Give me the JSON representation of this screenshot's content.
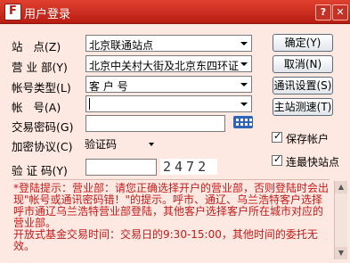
{
  "window": {
    "title": "用户登录",
    "help_label": "?",
    "close_label": "✕"
  },
  "form": {
    "station_label": "站   点(Z)",
    "station_value": "北京联通站点",
    "branch_label": "营 业 部(Y)",
    "branch_value": "北京中关村大街及北京东四环证",
    "account_type_label": "帐号类型(L)",
    "account_type_value": "客 户 号",
    "account_label": "帐   号(A)",
    "account_value": "",
    "password_label": "交易密码(G)",
    "encrypt_label": "加密协议(C)",
    "encrypt_value": "验证码",
    "captcha_label": "验 证 码(Y)",
    "captcha_value": "",
    "captcha_text": "2472"
  },
  "buttons": {
    "ok": "确定(Y)",
    "cancel": "取消(N)",
    "comm_settings": "通讯设置(S)",
    "speed_test": "主站测速(T)"
  },
  "options": {
    "save_account": {
      "label": "保存帐户",
      "checked": true
    },
    "fastest_station": {
      "label": "连最快站点",
      "checked": true
    }
  },
  "notice": "*登陆提示：营业部：请您正确选择开户的营业部，否则登陆时会出现\"帐号或通讯密码错！\"的提示。呼市、通辽、乌兰浩特客户选择呼市通辽乌兰浩特营业部登陆，其他客户选择客户所在城市对应的营业部。\n开放式基金交易时间：交易日的9:30-15:00，其他时间的委托无效。",
  "colors": {
    "title_bar": "#c8281b",
    "background": "#fde9e1",
    "notice_text": "#c41a1a"
  }
}
